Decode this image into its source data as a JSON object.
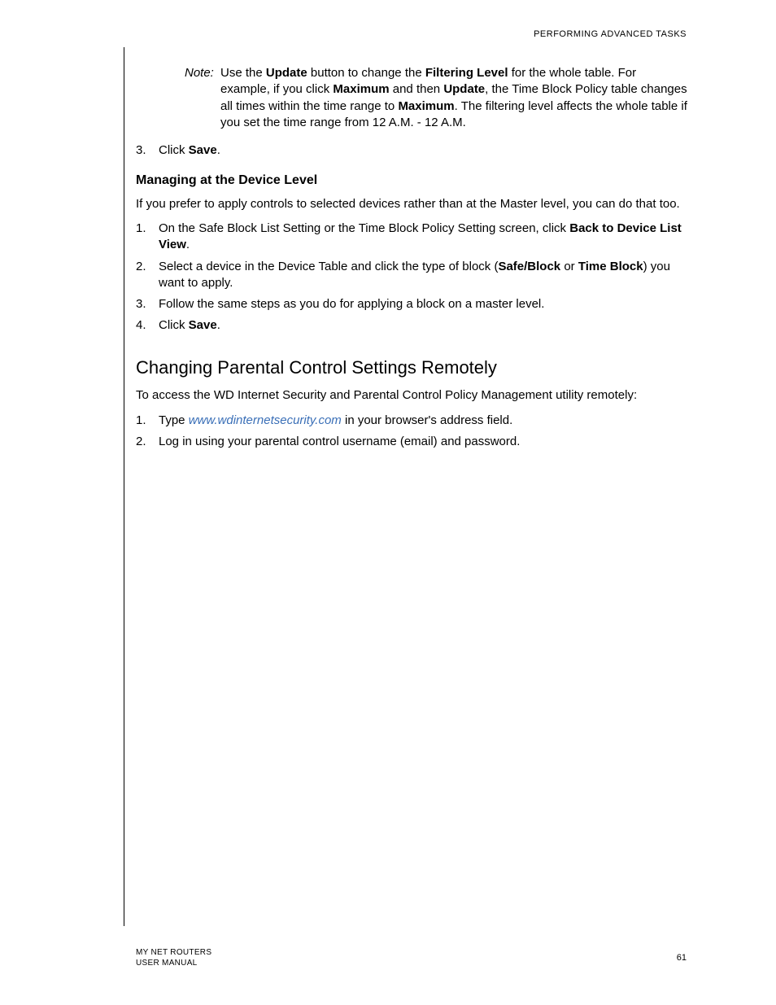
{
  "header": {
    "section": "PERFORMING ADVANCED TASKS"
  },
  "note": {
    "label": "Note:",
    "pre": "Use the ",
    "b1": "Update",
    "t1": " button to change the ",
    "b2": "Filtering Level",
    "t2": " for the whole table. For example, if you click ",
    "b3": "Maximum",
    "t3": " and then ",
    "b4": "Update",
    "t4": ", the Time Block Policy table changes all times within the time range to ",
    "b5": "Maximum",
    "t5": ". The filtering level affects the whole table if you set the time range from 12 A.M. - 12 A.M."
  },
  "step3top": {
    "num": "3.",
    "pre": "Click ",
    "b": "Save",
    "post": "."
  },
  "h3a": "Managing at the Device Level",
  "p1": "If you prefer to apply controls to selected devices rather than at the Master level, you can do that too.",
  "dev": {
    "s1": {
      "num": "1.",
      "pre": "On the Safe Block List Setting or the Time Block Policy Setting screen, click ",
      "b": "Back to Device List View",
      "post": "."
    },
    "s2": {
      "num": "2.",
      "pre": "Select a device in the Device Table and click the type of block (",
      "b1": "Safe/Block",
      "mid": " or ",
      "b2": "Time Block",
      "post": ") you want to apply."
    },
    "s3": {
      "num": "3.",
      "txt": "Follow the same steps as you do for applying a block on a master level."
    },
    "s4": {
      "num": "4.",
      "pre": "Click ",
      "b": "Save",
      "post": "."
    }
  },
  "h2": "Changing Parental Control Settings Remotely",
  "p2": "To access the WD Internet Security and Parental Control Policy Management utility remotely:",
  "remote": {
    "s1": {
      "num": "1.",
      "pre": "Type ",
      "link": "www.wdinternetsecurity.com",
      "post": " in your browser's address field."
    },
    "s2": {
      "num": "2.",
      "txt": "Log in using your parental control username (email) and password."
    }
  },
  "footer": {
    "left1": "MY NET ROUTERS",
    "left2": "USER MANUAL",
    "page": "61"
  }
}
